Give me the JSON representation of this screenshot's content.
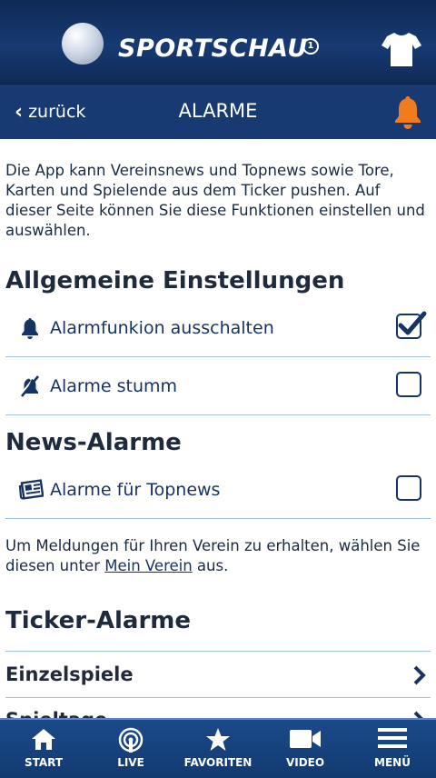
{
  "header": {
    "brand": "SPORTSCHAU",
    "brand_mark": "1"
  },
  "navbar": {
    "back_label": "zurück",
    "title": "ALARME"
  },
  "intro": "Die App kann Vereinsnews und Topnews sowie Tore, Karten und Spielende aus dem Ticker pushen. Auf dieser Seite können Sie diese Funktionen einstellen und auswählen.",
  "sections": {
    "general": {
      "title": "Allgemeine Einstellungen",
      "items": [
        {
          "label": "Alarmfunkion ausschalten",
          "icon": "bell-icon",
          "checked": true
        },
        {
          "label": "Alarme stumm",
          "icon": "mute-icon",
          "checked": false
        }
      ]
    },
    "news": {
      "title": "News-Alarme",
      "items": [
        {
          "label": "Alarme für Topnews",
          "icon": "newspaper-icon",
          "checked": false
        }
      ]
    },
    "info": {
      "before": "Um Meldungen für Ihren Verein zu erhalten, wählen Sie diesen unter ",
      "link": "Mein Verein",
      "after": " aus."
    },
    "ticker": {
      "title": "Ticker-Alarme",
      "items": [
        {
          "label": "Einzelspiele"
        },
        {
          "label": "Spieltage"
        }
      ]
    }
  },
  "tabbar": {
    "tabs": [
      {
        "label": "START",
        "icon": "home-icon"
      },
      {
        "label": "LIVE",
        "icon": "live-icon"
      },
      {
        "label": "FAVORITEN",
        "icon": "star-icon"
      },
      {
        "label": "VIDEO",
        "icon": "video-icon"
      },
      {
        "label": "MENÜ",
        "icon": "menu-icon"
      }
    ]
  },
  "colors": {
    "header": "#173a72",
    "accent": "#f07c1e",
    "text": "#163463",
    "divider": "#9cc3d6"
  }
}
